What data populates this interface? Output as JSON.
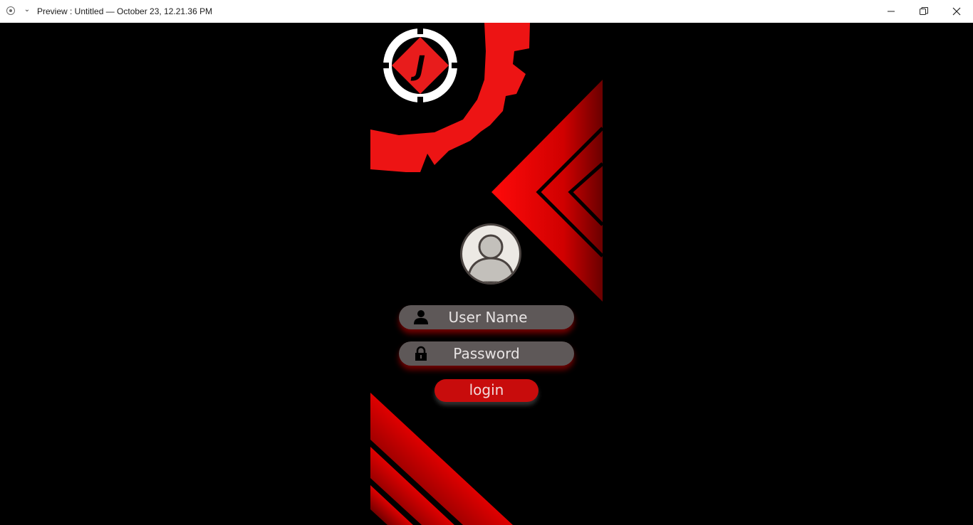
{
  "window": {
    "title": "Preview : Untitled — October 23, 12.21.36 PM",
    "controls": {
      "minimize": "minimize-icon",
      "maximize": "restore-icon",
      "close": "close-icon"
    }
  },
  "login": {
    "username_placeholder": "User Name",
    "password_placeholder": "Password",
    "button_label": "login"
  },
  "logo": {
    "mark": "J"
  },
  "colors": {
    "background": "#000000",
    "accent_red": "#e81010",
    "field_bg": "#5e5858",
    "button_bg": "#c80c0c"
  }
}
